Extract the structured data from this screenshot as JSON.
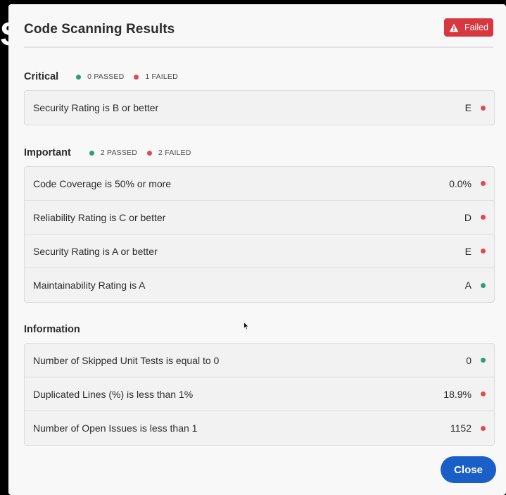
{
  "background_glyph": "S",
  "dialog": {
    "title": "Code Scanning Results",
    "status_badge": {
      "label": "Failed",
      "icon": "warning-triangle-icon",
      "color": "#d7373f"
    },
    "close_label": "Close"
  },
  "sections": [
    {
      "title": "Critical",
      "passed": "0 PASSED",
      "failed": "1 FAILED",
      "rows": [
        {
          "label": "Security Rating is B or better",
          "value": "E",
          "status": "failed"
        }
      ]
    },
    {
      "title": "Important",
      "passed": "2 PASSED",
      "failed": "2 FAILED",
      "rows": [
        {
          "label": "Code Coverage is 50% or more",
          "value": "0.0%",
          "status": "failed"
        },
        {
          "label": "Reliability Rating is C or better",
          "value": "D",
          "status": "failed"
        },
        {
          "label": "Security Rating is A or better",
          "value": "E",
          "status": "failed"
        },
        {
          "label": "Maintainability Rating is A",
          "value": "A",
          "status": "passed"
        }
      ]
    },
    {
      "title": "Information",
      "rows": [
        {
          "label": "Number of Skipped Unit Tests is equal to 0",
          "value": "0",
          "status": "passed"
        },
        {
          "label": "Duplicated Lines (%) is less than 1%",
          "value": "18.9%",
          "status": "failed"
        },
        {
          "label": "Number of Open Issues is less than 1",
          "value": "1152",
          "status": "failed"
        }
      ]
    }
  ],
  "colors": {
    "passed": "#2d9d78",
    "failed": "#e34850",
    "primary": "#1a5fc8"
  }
}
